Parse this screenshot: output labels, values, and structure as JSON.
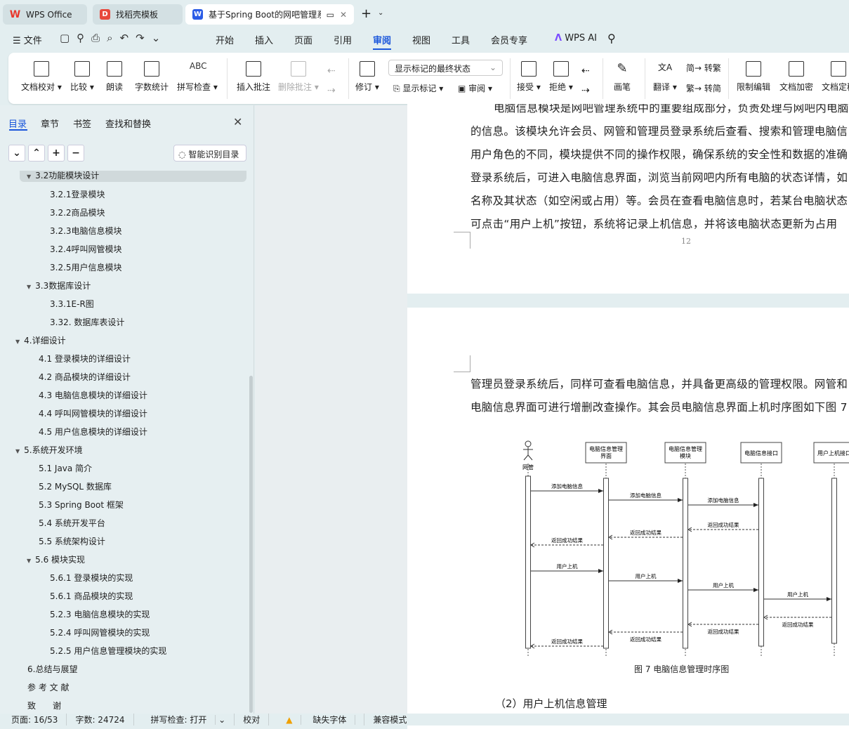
{
  "tabs": [
    {
      "label": "WPS Office",
      "icon": "wps-logo"
    },
    {
      "label": "找稻壳模板",
      "icon": "docer-logo"
    },
    {
      "label": "基于Spring Boot的网吧管理系",
      "icon": "word-doc-icon"
    }
  ],
  "menu": {
    "file": "文件",
    "items": [
      "开始",
      "插入",
      "页面",
      "引用",
      "审阅",
      "视图",
      "工具",
      "会员专享"
    ],
    "active": "审阅",
    "ai": "WPS AI"
  },
  "ribbon": {
    "buttons": [
      "文档校对",
      "比较",
      "朗读",
      "字数统计",
      "拼写检查",
      "插入批注",
      "删除批注",
      "修订",
      "接受",
      "拒绝",
      "画笔",
      "限制编辑",
      "文档加密",
      "文档定稿"
    ],
    "markup_select": "显示标记的最终状态",
    "show_markup": "显示标记",
    "review": "审阅",
    "translate": "翻译",
    "to_trad": "转繁",
    "to_simp": "转简"
  },
  "sidebar": {
    "tabs": [
      "目录",
      "章节",
      "书签",
      "查找和替换"
    ],
    "smart_toc": "智能识别目录",
    "toc": [
      {
        "label": "3.2功能模块设计",
        "level": 1,
        "expanded": true,
        "selected": true
      },
      {
        "label": "3.2.1登录模块",
        "level": 2
      },
      {
        "label": "3.2.2商品模块",
        "level": 2
      },
      {
        "label": "3.2.3电脑信息模块",
        "level": 2
      },
      {
        "label": "3.2.4呼叫网管模块",
        "level": 2
      },
      {
        "label": "3.2.5用户信息模块",
        "level": 2
      },
      {
        "label": "3.3数据库设计",
        "level": 1,
        "expanded": true
      },
      {
        "label": "3.3.1E-R图",
        "level": 2
      },
      {
        "label": "3.32. 数据库表设计",
        "level": 2
      },
      {
        "label": "4.详细设计",
        "level": 0,
        "expanded": true
      },
      {
        "label": "4.1 登录模块的详细设计",
        "level": 1
      },
      {
        "label": "4.2 商品模块的详细设计",
        "level": 1
      },
      {
        "label": "4.3 电脑信息模块的详细设计",
        "level": 1
      },
      {
        "label": "4.4 呼叫网管模块的详细设计",
        "level": 1
      },
      {
        "label": "4.5 用户信息模块的详细设计",
        "level": 1
      },
      {
        "label": "5.系统开发环境",
        "level": 0,
        "expanded": true
      },
      {
        "label": "5.1 Java 简介",
        "level": 1
      },
      {
        "label": "5.2 MySQL 数据库",
        "level": 1
      },
      {
        "label": "5.3 Spring Boot 框架",
        "level": 1
      },
      {
        "label": "5.4 系统开发平台",
        "level": 1
      },
      {
        "label": "5.5 系统架构设计",
        "level": 1
      },
      {
        "label": "5.6 模块实现",
        "level": 1,
        "expanded": true
      },
      {
        "label": "5.6.1 登录模块的实现",
        "level": 2
      },
      {
        "label": "5.6.1 商品模块的实现",
        "level": 2
      },
      {
        "label": "5.2.3 电脑信息模块的实现",
        "level": 2
      },
      {
        "label": "5.2.4 呼叫网管模块的实现",
        "level": 2
      },
      {
        "label": "5.2.5 用户信息管理模块的实现",
        "level": 2
      },
      {
        "label": "6.总结与展望",
        "level": 0
      },
      {
        "label": "参 考 文 献",
        "level": 0
      },
      {
        "label": "致　　谢",
        "level": 0
      }
    ]
  },
  "document": {
    "page1_lines": [
      "电脑信息模块是网吧管理系统中的重要组成部分，负责处理与网吧内电脑",
      "的信息。该模块允许会员、网管和管理员登录系统后查看、搜索和管理电脑信",
      "用户角色的不同，模块提供不同的操作权限，确保系统的安全性和数据的准确",
      "登录系统后，可进入电脑信息界面，浏览当前网吧内所有电脑的状态详情，如",
      "名称及其状态（如空闲或占用）等。会员在查看电脑信息时，若某台电脑状态",
      "可点击“用户上机”按钮，系统将记录上机信息，并将该电脑状态更新为占用"
    ],
    "page_number": "12",
    "page2_lines": [
      "管理员登录系统后，同样可查看电脑信息，并具备更高级的管理权限。网管和",
      "电脑信息界面可进行增删改查操作。其会员电脑信息界面上机时序图如下图 7"
    ],
    "caption": "图 7 电脑信息管理时序图",
    "subheading": "（2）用户上机信息管理"
  },
  "diagram": {
    "actor": "网管",
    "lifelines": [
      "电脑信息管理\n界面",
      "电脑信息管理\n模块",
      "电脑信息接口",
      "用户上机接口"
    ],
    "messages": [
      {
        "from": 0,
        "to": 1,
        "label": "添加电脑信息",
        "type": "sync"
      },
      {
        "from": 1,
        "to": 2,
        "label": "添加电脑信息",
        "type": "sync"
      },
      {
        "from": 2,
        "to": 3,
        "label": "添加电脑信息",
        "type": "sync"
      },
      {
        "from": 3,
        "to": 2,
        "label": "返回成功结果",
        "type": "return"
      },
      {
        "from": 2,
        "to": 1,
        "label": "返回成功结果",
        "type": "return"
      },
      {
        "from": 1,
        "to": 0,
        "label": "返回成功结果",
        "type": "return"
      },
      {
        "from": 0,
        "to": 1,
        "label": "用户上机",
        "type": "sync"
      },
      {
        "from": 1,
        "to": 2,
        "label": "用户上机",
        "type": "sync"
      },
      {
        "from": 2,
        "to": 3,
        "label": "用户上机",
        "type": "sync"
      },
      {
        "from": 3,
        "to": 4,
        "label": "用户上机",
        "type": "sync"
      },
      {
        "from": 4,
        "to": 3,
        "label": "返回成功结果",
        "type": "return"
      },
      {
        "from": 3,
        "to": 2,
        "label": "返回成功结果",
        "type": "return"
      },
      {
        "from": 2,
        "to": 1,
        "label": "返回成功结果",
        "type": "return"
      },
      {
        "from": 1,
        "to": 0,
        "label": "返回成功结果",
        "type": "return"
      }
    ]
  },
  "status": {
    "page": "页面: 16/53",
    "words": "字数: 24724",
    "spell": "拼写检查: 打开",
    "proof": "校对",
    "missing_font": "缺失字体",
    "compat": "兼容模式"
  },
  "colors": {
    "accent": "#1a56db",
    "wps_red": "#e8382c",
    "word_blue": "#2b5ce6"
  }
}
